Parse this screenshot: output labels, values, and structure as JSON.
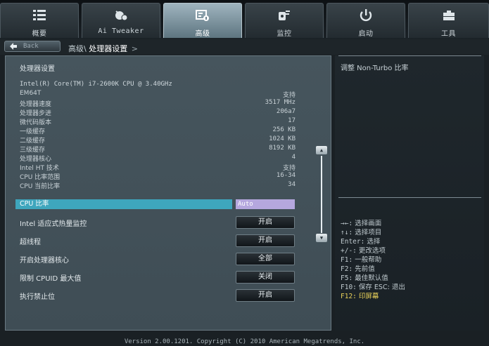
{
  "tabs": [
    {
      "label": "概要",
      "icon": "list-icon"
    },
    {
      "label": "Ai Tweaker",
      "icon": "tweaker-icon"
    },
    {
      "label": "高级",
      "icon": "advanced-icon",
      "active": true
    },
    {
      "label": "监控",
      "icon": "monitor-icon"
    },
    {
      "label": "启动",
      "icon": "power-icon"
    },
    {
      "label": "工具",
      "icon": "tools-icon"
    }
  ],
  "nav": {
    "back_label": "Back",
    "breadcrumb_parent": "高级\\",
    "breadcrumb_current": "处理器设置",
    "breadcrumb_arrow": ">"
  },
  "main": {
    "section_title": "处理器设置",
    "cpu_name": "Intel(R) Core(TM) i7-2600K CPU @ 3.40GHz",
    "info_rows": [
      {
        "label": "EM64T",
        "value": "支持"
      },
      {
        "label": "处理器速度",
        "value": "3517 MHz"
      },
      {
        "label": "处理器步进",
        "value": "206a7"
      },
      {
        "label": "微代码版本",
        "value": "17"
      },
      {
        "label": "一级缓存",
        "value": "256 KB"
      },
      {
        "label": "二级缓存",
        "value": "1024 KB"
      },
      {
        "label": "三级缓存",
        "value": "8192 KB"
      },
      {
        "label": "处理器核心",
        "value": "4"
      },
      {
        "label": "Intel HT 技术",
        "value": "支持"
      },
      {
        "label": "CPU 比率范围",
        "value": "16-34"
      },
      {
        "label": "CPU 当前比率",
        "value": "34"
      }
    ],
    "selected_option": {
      "label": "CPU 比率",
      "value": "Auto"
    },
    "options": [
      {
        "label": "Intel 适应式热量监控",
        "value": "开启"
      },
      {
        "label": "超线程",
        "value": "开启"
      },
      {
        "label": "开启处理器核心",
        "value": "全部"
      },
      {
        "label": "限制 CPUID 最大值",
        "value": "关闭"
      },
      {
        "label": "执行禁止位",
        "value": "开启"
      }
    ]
  },
  "help": {
    "description": "调整 Non-Turbo 比率",
    "keys": [
      {
        "key": "→←:",
        "desc": " 选择画面"
      },
      {
        "key": "↑↓:",
        "desc": " 选择项目"
      },
      {
        "key": "Enter:",
        "desc": " 选择"
      },
      {
        "key": "+/-:",
        "desc": " 更改选项"
      },
      {
        "key": "F1:",
        "desc": " 一般帮助"
      },
      {
        "key": "F2:",
        "desc": " 先前值"
      },
      {
        "key": "F5:",
        "desc": " 最佳默认值"
      },
      {
        "key": "F10:",
        "desc": " 保存  ESC: 退出"
      },
      {
        "key": "F12:",
        "desc": " 印屏幕",
        "highlight": true
      }
    ]
  },
  "footer": "Version 2.00.1201. Copyright (C) 2010 American Megatrends, Inc.",
  "colors": {
    "accent": "#3ea6bd",
    "selected_value": "#b5a7de",
    "highlight_key": "#e9d25a"
  }
}
